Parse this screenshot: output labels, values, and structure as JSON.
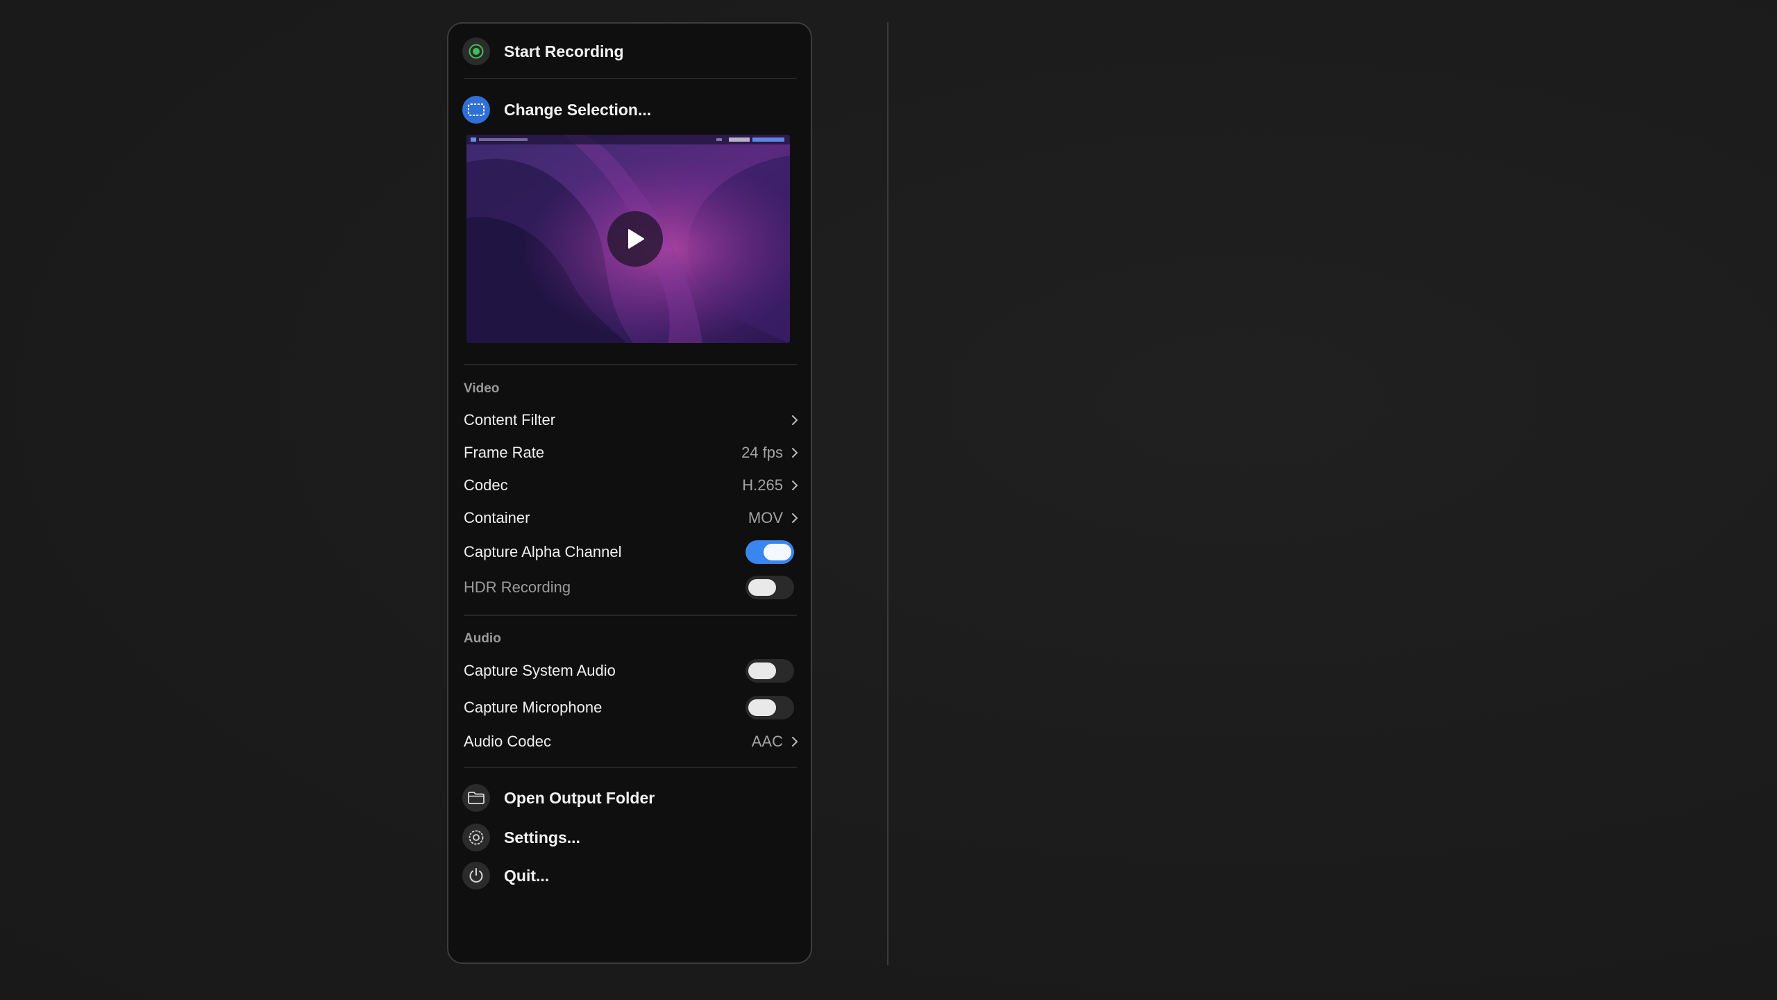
{
  "menu": {
    "start_recording": "Start Recording",
    "change_selection": "Change Selection...",
    "open_output_folder": "Open Output Folder",
    "settings": "Settings...",
    "quit": "Quit..."
  },
  "video": {
    "title": "Video",
    "content_filter": "Content Filter",
    "frame_rate_label": "Frame Rate",
    "frame_rate_value": "24 fps",
    "codec_label": "Codec",
    "codec_value": "H.265",
    "container_label": "Container",
    "container_value": "MOV",
    "capture_alpha_label": "Capture Alpha Channel",
    "capture_alpha_on": true,
    "hdr_label": "HDR Recording",
    "hdr_on": false
  },
  "audio": {
    "title": "Audio",
    "system_audio_label": "Capture System Audio",
    "system_audio_on": false,
    "microphone_label": "Capture Microphone",
    "microphone_on": false,
    "audio_codec_label": "Audio Codec",
    "audio_codec_value": "AAC"
  },
  "colors": {
    "accent": "#3a86f0",
    "record_green": "#3fbf5a",
    "panel_bg": "#0f0f0f"
  },
  "icons": [
    "record-icon",
    "selection-icon",
    "play-icon",
    "chevron-right-icon",
    "folder-icon",
    "gear-icon",
    "power-icon"
  ]
}
